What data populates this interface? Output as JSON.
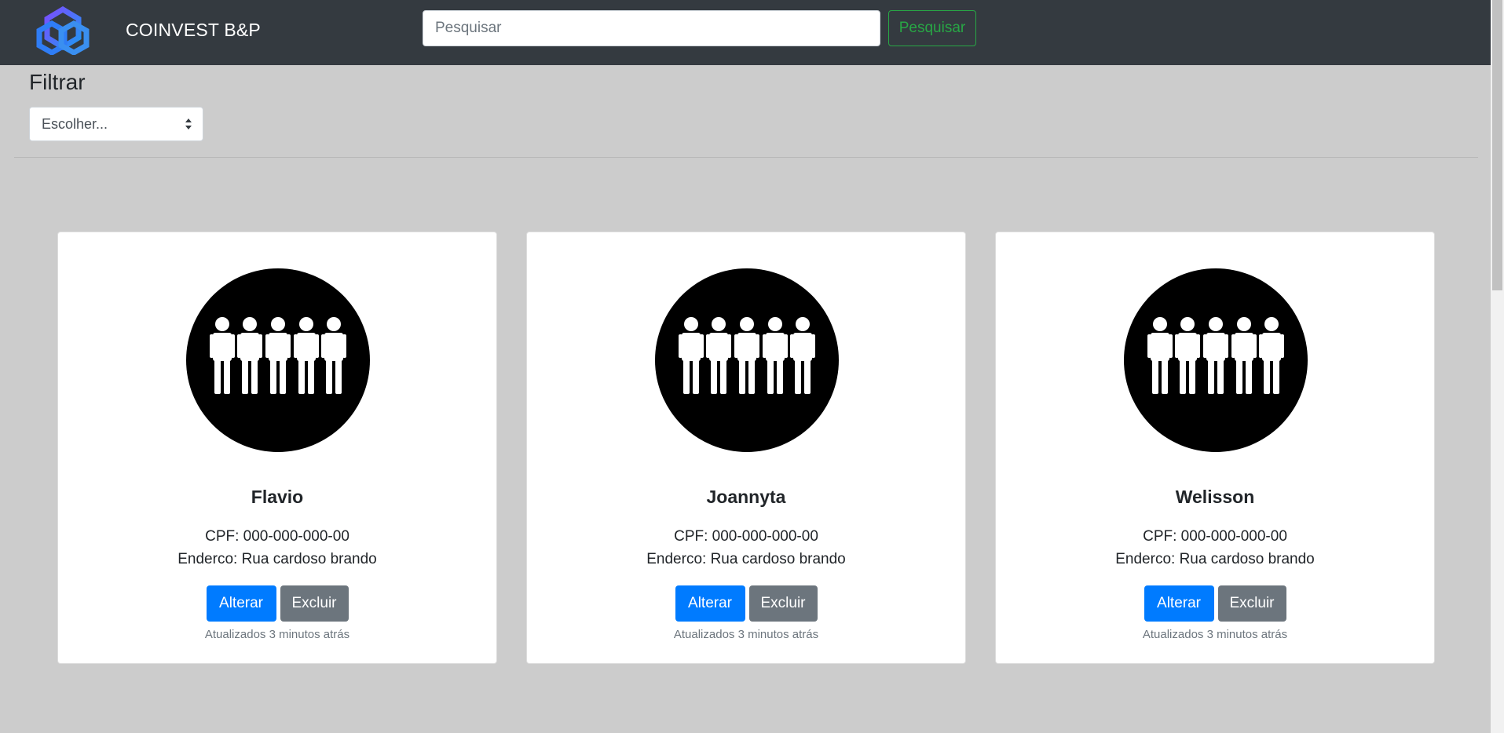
{
  "header": {
    "brand": "COINVEST B&P",
    "search_placeholder": "Pesquisar",
    "search_button": "Pesquisar"
  },
  "filter": {
    "title": "Filtrar",
    "selected": "Escolher..."
  },
  "cards": [
    {
      "name": "Flavio",
      "cpf": "CPF: 000-000-000-00",
      "address": "Enderco: Rua cardoso brando",
      "edit_label": "Alterar",
      "delete_label": "Excluir",
      "updated": "Atualizados 3 minutos atrás"
    },
    {
      "name": "Joannyta",
      "cpf": "CPF: 000-000-000-00",
      "address": "Enderco: Rua cardoso brando",
      "edit_label": "Alterar",
      "delete_label": "Excluir",
      "updated": "Atualizados 3 minutos atrás"
    },
    {
      "name": "Welisson",
      "cpf": "CPF: 000-000-000-00",
      "address": "Enderco: Rua cardoso brando",
      "edit_label": "Alterar",
      "delete_label": "Excluir",
      "updated": "Atualizados 3 minutos atrás"
    }
  ],
  "icons": {
    "logo": "hexagon-logo-icon",
    "avatar": "group-people-icon",
    "select": "select-arrows-icon"
  },
  "colors": {
    "navbar": "#343a40",
    "background": "#cccccc",
    "primary": "#007bff",
    "secondary": "#6c757d",
    "success": "#28a745"
  }
}
